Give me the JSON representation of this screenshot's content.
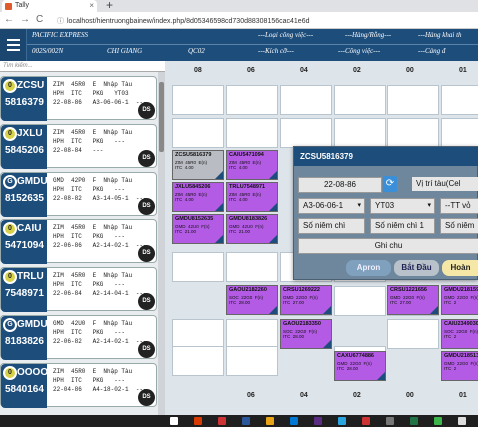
{
  "browser": {
    "tab_title": "Tally",
    "tab_close": "×",
    "new_tab": "+",
    "url": "localhost/hientruongbainew/index.php/8d05346598cd730d88308156cac41e6d",
    "back": "←",
    "forward": "→",
    "reload": "C"
  },
  "header": {
    "vessel": "PACIFIC EXPRESS",
    "row1": [
      "---Loại công việc---",
      "---Hàng/Rỗng---",
      "---Hàng khai th"
    ],
    "voyage": "002S/002N",
    "operator": "CHI GIANG",
    "qc": "QC02",
    "row2": [
      "---Kích cỡ---",
      "---Công việc---",
      "---Cảng đ"
    ]
  },
  "sidebar": {
    "search_placeholder": "Tìm kiếm...",
    "cards": [
      {
        "prefix": "ZCSU",
        "number": "5816379",
        "dot": "0",
        "dot_color": "#d8d24a",
        "line1": "ZIM  45R0  E  Nhập Tàu",
        "line2": "HPH  ITC   PKG   YT03",
        "line3": "22-08-86   A3-06-06-1  ---",
        "badge": "DS"
      },
      {
        "prefix": "JXLU",
        "number": "5845206",
        "dot": "0",
        "dot_color": "#d8d24a",
        "line1": "ZIM  45R0  E  Nhập Tàu",
        "line2": "HPH  ITC   PKG   ---",
        "line3": "22-08-84   ---",
        "badge": "DS"
      },
      {
        "prefix": "GMDU",
        "number": "8152635",
        "dot": "G",
        "dot_color": "#1d4d7b",
        "line1": "GMD  42P0  F  Nhập Tàu",
        "line2": "HPH  ITC   PKG   ---",
        "line3": "22-08-82   A3-14-05-1  ---",
        "badge": "DS"
      },
      {
        "prefix": "CAIU",
        "number": "5471094",
        "dot": "0",
        "dot_color": "#d8d24a",
        "line1": "ZIM  45R0  E  Nhập Tàu",
        "line2": "HPH  ITC   PKG   ---",
        "line3": "22-06-86   A2-14-02-1  ---",
        "badge": "DS"
      },
      {
        "prefix": "TRLU",
        "number": "7548971",
        "dot": "0",
        "dot_color": "#d8d24a",
        "line1": "ZIM  45R0  E  Nhập Tàu",
        "line2": "HPH  ITC   PKG   ---",
        "line3": "22-06-84   A2-14-04-1  ---",
        "badge": "DS"
      },
      {
        "prefix": "GMDU",
        "number": "8183826",
        "dot": "G",
        "dot_color": "#1d4d7b",
        "line1": "GMD  42U0  F  Nhập Tàu",
        "line2": "HPH  ITC   PKG   ---",
        "line3": "22-06-82   A2-14-02-1  ---",
        "badge": "DS"
      },
      {
        "prefix": "OOOO",
        "number": "5840164",
        "dot": "0",
        "dot_color": "#d8d24a",
        "line1": "ZIM  45R0  E  Nhập Tàu",
        "line2": "HPH  ITC   PKG   ---",
        "line3": "22-04-86   A4-18-02-1  ---",
        "badge": "DS"
      }
    ]
  },
  "grid": {
    "columns": [
      "08",
      "06",
      "04",
      "02",
      "00",
      "01"
    ],
    "bottom_columns": [
      "06",
      "04",
      "02",
      "00",
      "01"
    ],
    "bays": [
      {
        "name": "ZCSU5816379",
        "line": "ZIM  45R0  E(n)\nITC  4.00",
        "kind": "g"
      },
      {
        "name": "CAIU5471094",
        "line": "ZIM  45R0  E(n)\nITC  4.00",
        "kind": "p"
      },
      {
        "name": "JXLU5845206",
        "line": "ZIM  45R0  E(n)\nITC  4.00",
        "kind": "p"
      },
      {
        "name": "TRLU7548971",
        "line": "ZIM  45R0  E(n)\nITC  4.00",
        "kind": "p"
      },
      {
        "name": "GMDU8152635",
        "line": "GMD  42U0  F(n)\nITC  21.00",
        "kind": "p"
      },
      {
        "name": "GMDU8183826",
        "line": "GMD  42U0  F(n)\nITC  21.00",
        "kind": "p"
      },
      {
        "name": "GAOU2182260",
        "line": "SOC  22G0  F(n)\nITC  28.00",
        "kind": "p"
      },
      {
        "name": "CRSU1269222",
        "line": "GMD  22G0  F(n)\nITC  27.00",
        "kind": "p"
      },
      {
        "name": "GAOU2183350",
        "line": "SOC  22G0  F(n)\nITC  28.00",
        "kind": "p"
      },
      {
        "name": "CRSU1221656",
        "line": "GMD  22G0  F(n)\nITC  27.00",
        "kind": "p"
      },
      {
        "name": "GMDU2181591",
        "line": "GMD  22G0  F(n)\nITC  2",
        "kind": "p"
      },
      {
        "name": "CAIU2349030",
        "line": "SOC  22G0  F(n)\nITC  2",
        "kind": "p"
      },
      {
        "name": "CAXU6774886",
        "line": "GMD  22G0  F(n)\nITC  28.00",
        "kind": "p"
      },
      {
        "name": "GMDU2185135",
        "line": "GMD  22G0  F(n)\nITC  2",
        "kind": "p"
      }
    ]
  },
  "popup": {
    "title": "ZCSU5816379",
    "date": "22-08-86",
    "position_label": "Vị trí tàu(Cel",
    "location": "A3-06-06-1",
    "yard": "YT03",
    "tt": "--TT vỏ",
    "seal1": "Số niêm chì",
    "seal2": "Số niêm chì 1",
    "seal3": "Số niêm",
    "note": "Ghi chu",
    "btn_apron": "Apron",
    "btn_start": "Bắt Đầu",
    "btn_done": "Hoàn"
  },
  "colors": {
    "header": "#1d4d7b",
    "bay_selected": "#b45be6",
    "bay_done": "#b9bcc3",
    "popup_bg": "#6e879d",
    "btn_start": "#b9c2ca",
    "btn_done": "#f5e7a6"
  }
}
